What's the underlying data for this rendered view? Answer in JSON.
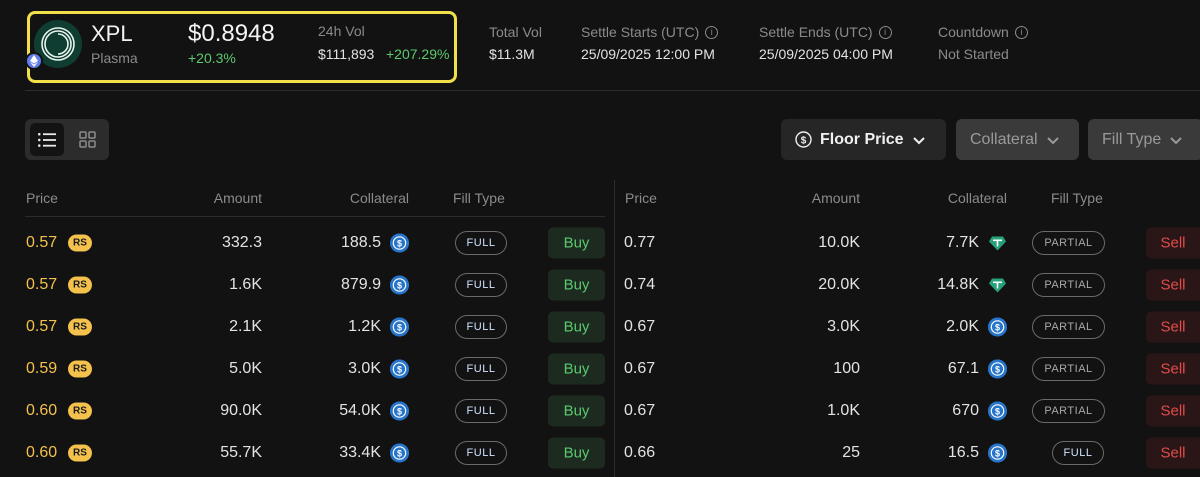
{
  "token": {
    "symbol": "XPL",
    "name": "Plasma",
    "price": "$0.8948",
    "change": "+20.3%",
    "vol_label": "24h Vol",
    "vol_value": "$111,893",
    "vol_change": "+207.29%",
    "logo_icon": "plasma-logo-icon",
    "chain_icon": "ethereum-chain-icon"
  },
  "stats": [
    {
      "label": "Total Vol",
      "value": "$11.3M",
      "info": false
    },
    {
      "label": "Settle Starts (UTC)",
      "value": "25/09/2025 12:00 PM",
      "info": true
    },
    {
      "label": "Settle Ends (UTC)",
      "value": "25/09/2025 04:00 PM",
      "info": true
    },
    {
      "label": "Countdown",
      "value": "Not Started",
      "info": true
    }
  ],
  "toolbar": {
    "list_view_icon": "list-view-icon",
    "grid_view_icon": "grid-view-icon",
    "floor_price": "Floor Price",
    "collateral": "Collateral",
    "fill_type": "Fill Type"
  },
  "buy_table": {
    "headers": {
      "price": "Price",
      "amount": "Amount",
      "collateral": "Collateral",
      "fill_type": "Fill Type"
    },
    "badge": "RS",
    "action": "Buy",
    "rows": [
      {
        "price": "0.57",
        "amount": "332.3",
        "collateral": "188.5",
        "coin": "usdc",
        "fill": "FULL"
      },
      {
        "price": "0.57",
        "amount": "1.6K",
        "collateral": "879.9",
        "coin": "usdc",
        "fill": "FULL"
      },
      {
        "price": "0.57",
        "amount": "2.1K",
        "collateral": "1.2K",
        "coin": "usdc",
        "fill": "FULL"
      },
      {
        "price": "0.59",
        "amount": "5.0K",
        "collateral": "3.0K",
        "coin": "usdc",
        "fill": "FULL"
      },
      {
        "price": "0.60",
        "amount": "90.0K",
        "collateral": "54.0K",
        "coin": "usdc",
        "fill": "FULL"
      },
      {
        "price": "0.60",
        "amount": "55.7K",
        "collateral": "33.4K",
        "coin": "usdc",
        "fill": "FULL"
      }
    ]
  },
  "sell_table": {
    "headers": {
      "price": "Price",
      "amount": "Amount",
      "collateral": "Collateral",
      "fill_type": "Fill Type"
    },
    "action": "Sell",
    "rows": [
      {
        "price": "0.77",
        "amount": "10.0K",
        "collateral": "7.7K",
        "coin": "usdt",
        "fill": "PARTIAL"
      },
      {
        "price": "0.74",
        "amount": "20.0K",
        "collateral": "14.8K",
        "coin": "usdt",
        "fill": "PARTIAL"
      },
      {
        "price": "0.67",
        "amount": "3.0K",
        "collateral": "2.0K",
        "coin": "usdc",
        "fill": "PARTIAL"
      },
      {
        "price": "0.67",
        "amount": "100",
        "collateral": "67.1",
        "coin": "usdc",
        "fill": "PARTIAL"
      },
      {
        "price": "0.67",
        "amount": "1.0K",
        "collateral": "670",
        "coin": "usdc",
        "fill": "PARTIAL"
      },
      {
        "price": "0.66",
        "amount": "25",
        "collateral": "16.5",
        "coin": "usdc",
        "fill": "FULL"
      }
    ]
  },
  "colors": {
    "highlight": "#f1e04a",
    "positive": "#5bc96d",
    "negative": "#e34b4b",
    "price_accent": "#f3c14c",
    "usdc": "#2775ca",
    "usdt": "#26a17b"
  }
}
